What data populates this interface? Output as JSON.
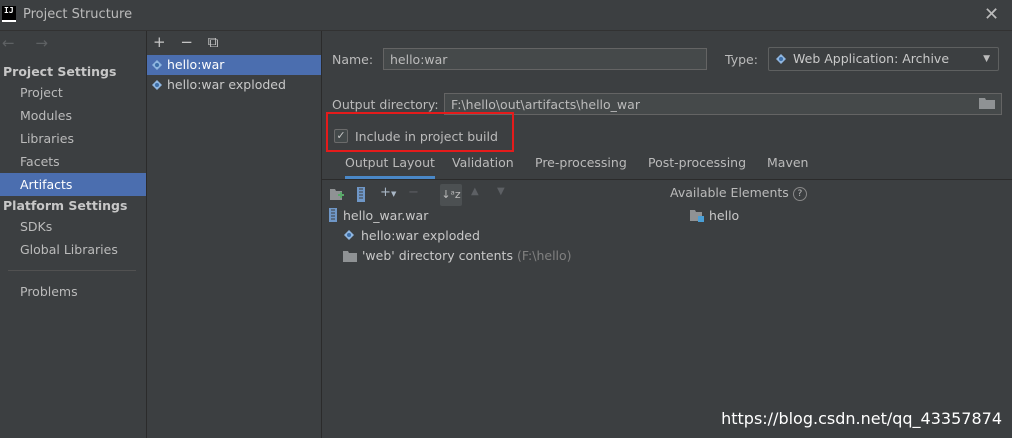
{
  "window": {
    "title": "Project Structure",
    "app_icon_text": "IJ"
  },
  "nav": {
    "arrows": "← →",
    "sections": [
      {
        "title": "Project Settings",
        "items": [
          "Project",
          "Modules",
          "Libraries",
          "Facets",
          "Artifacts"
        ]
      },
      {
        "title": "Platform Settings",
        "items": [
          "SDKs",
          "Global Libraries"
        ]
      }
    ],
    "problems": "Problems",
    "selected": "Artifacts"
  },
  "artifact_list": {
    "tools": [
      "+",
      "−",
      "⧉"
    ],
    "items": [
      "hello:war",
      "hello:war exploded"
    ],
    "selected": "hello:war"
  },
  "form": {
    "name_label": "Name:",
    "name_value": "hello:war",
    "type_label": "Type:",
    "type_value": "Web Application: Archive",
    "output_dir_label": "Output directory:",
    "output_dir_value": "F:\\hello\\out\\artifacts\\hello_war",
    "include_label": "Include in project build",
    "include_checked": true
  },
  "tabs": [
    "Output Layout",
    "Validation",
    "Pre-processing",
    "Post-processing",
    "Maven"
  ],
  "active_tab": "Output Layout",
  "layout_toolbar": {
    "add": "+",
    "remove": "−",
    "sort": "↓a​z",
    "up": "▲",
    "down": "▼"
  },
  "available_elements": {
    "label": "Available Elements",
    "help": "?",
    "items": [
      "hello"
    ]
  },
  "layout_tree": {
    "root": "hello_war.war",
    "children": [
      {
        "label": "hello:war exploded"
      },
      {
        "label": "'web' directory contents",
        "hint": "(F:\\hello)"
      }
    ]
  },
  "watermark": "https://blog.csdn.net/qq_43357874",
  "colors": {
    "accent": "#4b6eaf",
    "highlight": "#e51b1b",
    "tab_underline": "#4a88c7"
  }
}
